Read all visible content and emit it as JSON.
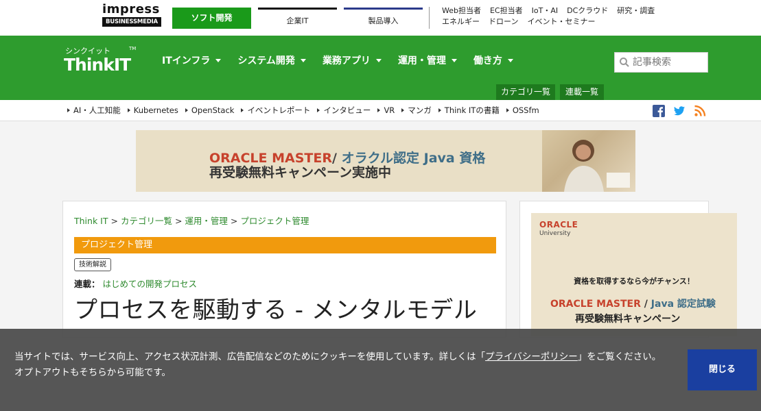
{
  "topbar": {
    "impress_logo": "impress",
    "impress_sub": "BUSINESSMEDIA",
    "soft_button": "ソフト開発",
    "nav1": "企業IT",
    "nav2": "製品導入",
    "links_row1": [
      "Web担当者",
      "EC担当者",
      "IoT・AI",
      "DCクラウド",
      "研究・調査"
    ],
    "links_row2": [
      "エネルギー",
      "ドローン",
      "イベント・セミナー"
    ]
  },
  "header": {
    "logo_kana": "シンクイット",
    "logo_text": "ThinkIT",
    "logo_tm": "TM",
    "nav": [
      "ITインフラ",
      "システム開発",
      "業務アプリ",
      "運用・管理",
      "働き方"
    ],
    "search_placeholder": "記事検索",
    "subtabs": [
      "カテゴリ一覧",
      "連載一覧"
    ]
  },
  "subnav": {
    "links": [
      "AI・人工知能",
      "Kubernetes",
      "OpenStack",
      "イベントレポート",
      "インタビュー",
      "VR",
      "マンガ",
      "Think ITの書籍",
      "OSSfm"
    ]
  },
  "banner": {
    "oracle": "ORACLE MASTER",
    "slash": "/",
    "java": "オラクル認定 Java 資格",
    "line2": "再受験無料キャンペーン実施中"
  },
  "article": {
    "breadcrumb": [
      "Think IT",
      "カテゴリ一覧",
      "運用・管理",
      "プロジェクト管理"
    ],
    "breadcrumb_sep": ">",
    "category": "プロジェクト管理",
    "tag": "技術解説",
    "serial_label": "連載：",
    "serial_value": "はじめての開発プロセス",
    "title": "プロセスを駆動する - メンタルモデル"
  },
  "side_banner": {
    "oracle_logo": "ORACLE",
    "oracle_uni": "University",
    "line1": "資格を取得するなら今がチャンス！",
    "oracle": "ORACLE MASTER",
    "slash": "/",
    "java": "Java 認定試験",
    "line3": "再受験無料キャンペーン"
  },
  "cookie": {
    "text_before": "当サイトでは、サービス向上、アクセス状況計測、広告配信などのためにクッキーを使用しています。詳しくは「",
    "link": "プライバシーポリシー",
    "text_after": "」をご覧ください。オプトアウトもそちらから可能です。",
    "close": "閉じる"
  },
  "colors": {
    "brand_green": "#2e9c2e",
    "category_orange": "#f19a0d",
    "close_blue": "#1a3fa0"
  }
}
